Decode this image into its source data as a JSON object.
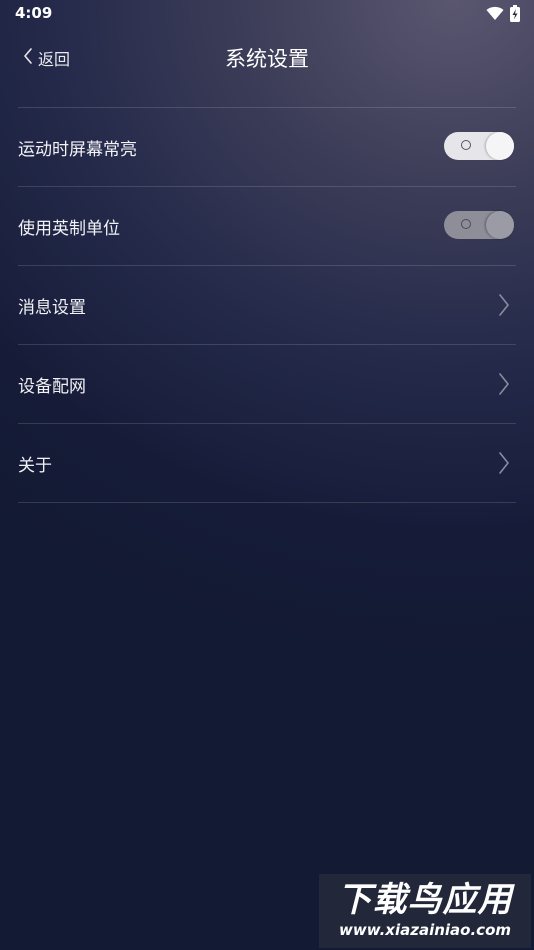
{
  "status_bar": {
    "time": "4:09",
    "icons": [
      "wifi-icon",
      "battery-charging-icon"
    ]
  },
  "header": {
    "back_label": "返回",
    "title": "系统设置"
  },
  "settings": {
    "rows": [
      {
        "label": "运动时屏幕常亮",
        "control": "toggle",
        "state": "off"
      },
      {
        "label": "使用英制单位",
        "control": "toggle",
        "state": "off-disabled"
      },
      {
        "label": "消息设置",
        "control": "chevron"
      },
      {
        "label": "设备配网",
        "control": "chevron"
      },
      {
        "label": "关于",
        "control": "chevron"
      }
    ]
  },
  "watermark": {
    "brand": "下载鸟应用",
    "url": "www.xiazainiao.com"
  },
  "colors": {
    "background_top": "#5a5670",
    "background_bottom": "#131a33",
    "divider": "#ffffff24",
    "toggle_track": "#e6e6ea",
    "toggle_track_dim": "#8d8e98"
  }
}
